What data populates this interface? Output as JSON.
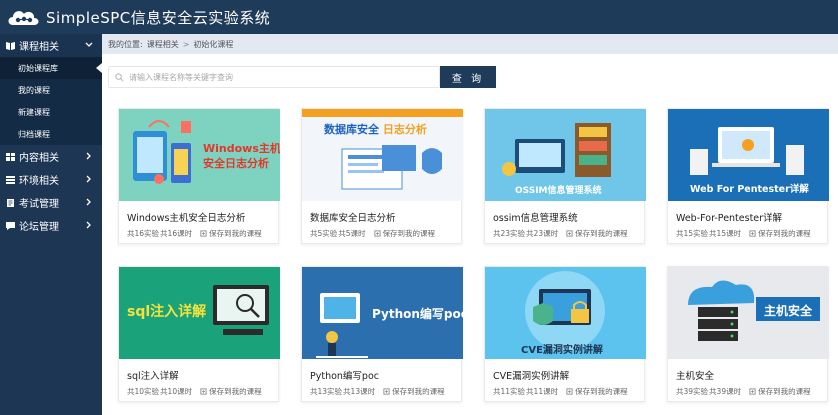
{
  "app": {
    "title": "SimpleSPC信息安全云实验系统"
  },
  "sidebar": {
    "groups": [
      {
        "label": "课程相关",
        "open": true,
        "items": [
          {
            "label": "初始课程库",
            "active": true
          },
          {
            "label": "我的课程"
          },
          {
            "label": "新建课程"
          },
          {
            "label": "归档课程"
          }
        ]
      },
      {
        "label": "内容相关"
      },
      {
        "label": "环境相关"
      },
      {
        "label": "考试管理"
      },
      {
        "label": "论坛管理"
      }
    ]
  },
  "breadcrumb": {
    "prefix": "我的位置:",
    "items": [
      "课程相关",
      "初始化课程"
    ],
    "sep": ">"
  },
  "search": {
    "placeholder": "请输入课程名称等关键字查询",
    "button_label": "查 询"
  },
  "courses": [
    {
      "title": "Windows主机安全日志分析",
      "experiments": "共16实验",
      "hours": "共16课时",
      "save": "保存到我的课程",
      "caption": "Windows主机\n安全日志分析",
      "bg": "#7dd3c0"
    },
    {
      "title": "数据库安全日志分析",
      "experiments": "共5实验",
      "hours": "共5课时",
      "save": "保存到我的课程",
      "caption": "数据库安全 日志分析",
      "bg": "#f2f6fb"
    },
    {
      "title": "ossim信息管理系统",
      "experiments": "共23实验",
      "hours": "共23课时",
      "save": "保存到我的课程",
      "caption": "OSSIM信息管理系统",
      "bg": "#6fc6e8"
    },
    {
      "title": "Web-For-Pentester详解",
      "experiments": "共15实验",
      "hours": "共15课时",
      "save": "保存到我的课程",
      "caption": "Web For Pentester详解",
      "bg": "#1a6fb7"
    },
    {
      "title": "sql注入详解",
      "experiments": "共10实验",
      "hours": "共10课时",
      "save": "保存到我的课程",
      "caption": "sql注入详解",
      "bg": "#1aa37a"
    },
    {
      "title": "Python编写poc",
      "experiments": "共13实验",
      "hours": "共13课时",
      "save": "保存到我的课程",
      "caption": "Python编写poc",
      "bg": "#2c6fae"
    },
    {
      "title": "CVE漏洞实例讲解",
      "experiments": "共11实验",
      "hours": "共11课时",
      "save": "保存到我的课程",
      "caption": "CVE漏洞实例讲解",
      "bg": "#5cc3ef"
    },
    {
      "title": "主机安全",
      "experiments": "共39实验",
      "hours": "共39课时",
      "save": "保存到我的课程",
      "caption": "主机安全",
      "bg": "#e7e9ec"
    }
  ]
}
